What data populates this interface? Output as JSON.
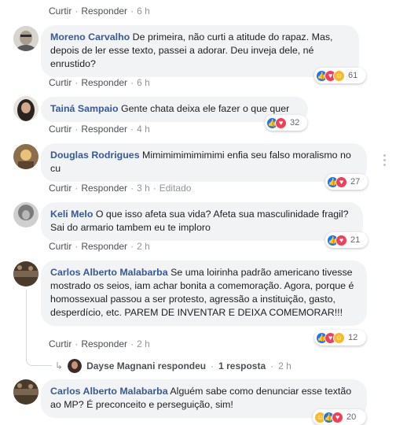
{
  "actions": {
    "like": "Curtir",
    "reply": "Responder",
    "edited": "Editado",
    "dot": "·"
  },
  "top": {
    "time": "6 h"
  },
  "comments": [
    {
      "author": "Moreno Carvalho",
      "text": "De primeira, não curti a atitude do rapaz. Mas, depois de ler esse texto, passei a adorar. Deu inveja dele, né enrustido?",
      "time": "6 h",
      "reaction_icons": [
        "like-icon",
        "love-icon",
        "haha-icon"
      ],
      "reaction_count": "61"
    },
    {
      "author": "Tainá Sampaio",
      "text": "Gente chata deixa ele fazer o que quer",
      "time": "4 h",
      "reaction_icons": [
        "like-icon",
        "love-icon"
      ],
      "reaction_count": "32"
    },
    {
      "author": "Douglas Rodrigues",
      "text": "Mimimimimimimimi enfia seu falso moralismo no cu",
      "time": "3 h",
      "edited": true,
      "reaction_icons": [
        "like-icon",
        "love-icon"
      ],
      "reaction_count": "27"
    },
    {
      "author": "Keli Melo",
      "text": "O que isso afeta sua vida? Afeta sua masculinidade fragil? Sai do armario tambem eu te imploro",
      "time": "2 h",
      "reaction_icons": [
        "like-icon",
        "love-icon"
      ],
      "reaction_count": "21"
    },
    {
      "author": "Carlos Alberto Malabarba",
      "text": "Se uma loirinha padrão americano tivesse mostrado os seios, iam achar bonita a comemoração. Agora, porque é homossexual passou a ser protesto, agressão a instituição, gasto, desperdício, etc. PAREM DE INVENTAR E DEIXA COMEMORAR!!!",
      "time": "2 h",
      "reaction_icons": [
        "like-icon",
        "love-icon",
        "haha-icon"
      ],
      "reaction_count": "12"
    },
    {
      "author": "Carlos Alberto Malabarba",
      "text": "Alguém sabe como denunciar esse textão ao MP? É preconceito e perseguição, sim!",
      "reaction_icons": [
        "haha-icon",
        "like-icon",
        "love-icon"
      ],
      "reaction_count": "20"
    }
  ],
  "reply_summary": {
    "name": "Dayse Magnani",
    "verb": "respondeu",
    "count": "1 resposta",
    "time": "2 h"
  },
  "colors": {
    "author": "#385898",
    "bubble": "#f2f3f5",
    "like": "#1877f2",
    "love": "#f33e58",
    "haha": "#f7b928"
  }
}
